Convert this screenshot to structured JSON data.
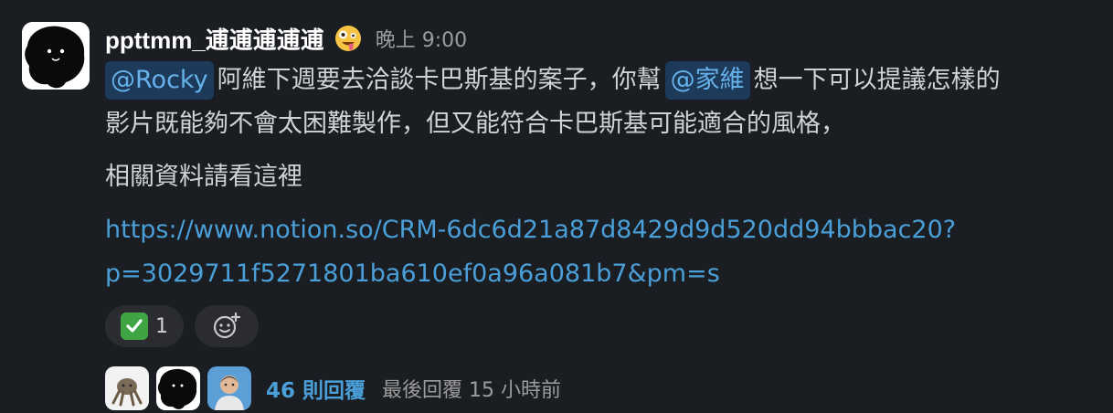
{
  "message": {
    "username": "ppttmm_逋逋逋逋逋",
    "status_emoji": "zany-face",
    "timestamp": "晚上 9:00",
    "line1": {
      "mention1": "@Rocky",
      "text1": "阿維下週要去洽談卡巴斯基的案子，你幫",
      "mention2": "@家維",
      "text2": "想一下可以提議怎樣的"
    },
    "line2": "影片既能夠不會太困難製作，但又能符合卡巴斯基可能適合的風格，",
    "line3": "相關資料請看這裡",
    "link_line1": "https://www.notion.so/CRM-6dc6d21a87d8429d9d520dd94bbbac20?",
    "link_line2": "p=3029711f5271801ba610ef0a96a081b7&pm=s"
  },
  "reactions": [
    {
      "emoji": "white-check-mark",
      "count": "1"
    }
  ],
  "thread": {
    "reply_count": "46 則回覆",
    "last_reply": "最後回覆 15 小時前"
  },
  "colors": {
    "background": "#1a1d21",
    "text": "#d1d2d3",
    "link": "#4a9fd8",
    "mention_bg": "#1d3a5b",
    "mention_text": "#66b2ea",
    "meta": "#9c9c9c"
  }
}
